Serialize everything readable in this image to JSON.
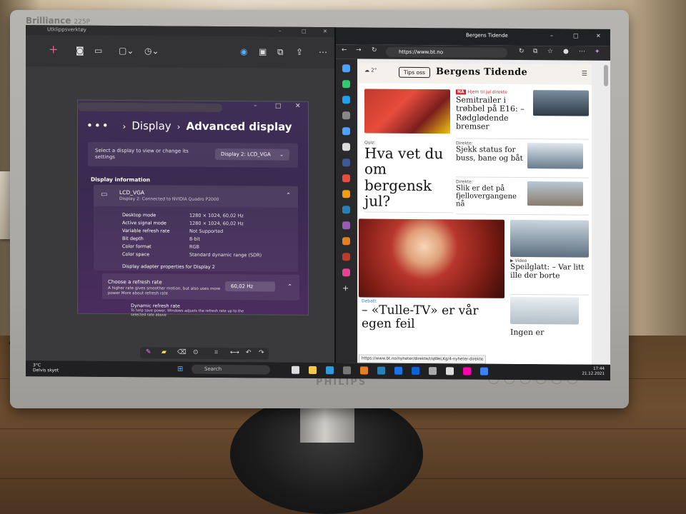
{
  "monitor": {
    "brand": "Brilliance",
    "model": "225P",
    "logo": "PHILIPS"
  },
  "left_window": {
    "title": "Utklippsverktøy",
    "settings": {
      "breadcrumb": {
        "dots": "•••",
        "parent": "Display",
        "current": "Advanced display"
      },
      "select_label": "Select a display to view or change its settings",
      "select_value": "Display 2: LCD_VGA",
      "section_heading": "Display information",
      "monitor_name": "LCD_VGA",
      "monitor_sub": "Display 2: Connected to NVIDIA Quadro P2000",
      "rows": [
        {
          "k": "Desktop mode",
          "v": "1280 × 1024, 60,02 Hz"
        },
        {
          "k": "Active signal mode",
          "v": "1280 × 1024, 60,02 Hz"
        },
        {
          "k": "Variable refresh rate",
          "v": "Not Supported"
        },
        {
          "k": "Bit depth",
          "v": "8-bit"
        },
        {
          "k": "Color format",
          "v": "RGB"
        },
        {
          "k": "Color space",
          "v": "Standard dynamic range (SDR)"
        }
      ],
      "adapter_link": "Display adapter properties for Display 2",
      "refresh_title": "Choose a refresh rate",
      "refresh_sub": "A higher rate gives smoother motion, but also uses more power  More about refresh rate",
      "refresh_value": "60,02 Hz",
      "dynamic_title": "Dynamic refresh rate",
      "dynamic_sub": "To help save power, Windows adjusts the refresh rate up to the selected rate above"
    }
  },
  "browser": {
    "title": "Bergens Tidende",
    "url": "https://www.bt.no",
    "weather": "2°",
    "tips_button": "Tips oss",
    "masthead": "Bergens Tidende",
    "articles": {
      "a1": {
        "badge": "NÅ",
        "kicker": "Hjem til jul direkte",
        "headline": "Semitrailer i trøbbel på E16: – Rødglødende bremser"
      },
      "a2": {
        "kicker": "Quiz:",
        "headline": "Hva vet du om bergensk jul?"
      },
      "a3": {
        "kicker": "Direkte:",
        "headline": "Sjekk status for buss, bane og båt"
      },
      "a4": {
        "kicker": "Direkte:",
        "headline": "Slik er det på fjellovergangene nå"
      },
      "a5": {
        "kicker": "Debatt",
        "headline": "– «Tulle-TV» er vår egen feil"
      },
      "a6": {
        "kicker": "Video",
        "headline": "Speilglatt: – Var litt ille der borte"
      },
      "a7": {
        "headline": "Ingen er"
      }
    },
    "status_url": "https://www.bt.no/nyheter/direkte/i/qWeLKg/4-nyheter-direkte"
  },
  "taskbar": {
    "weather_temp": "3°C",
    "weather_desc": "Delvis skyet",
    "search": "Search",
    "time": "17:44",
    "date": "21.12.2021"
  }
}
